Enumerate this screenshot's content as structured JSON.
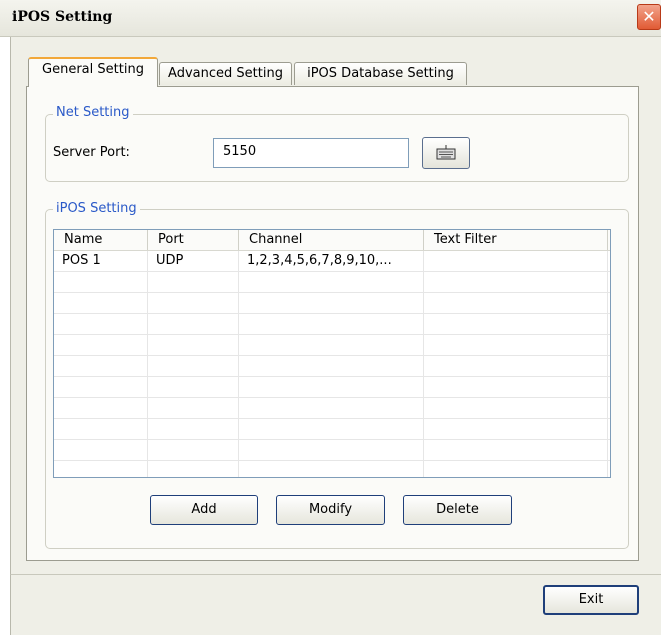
{
  "window": {
    "title": "iPOS Setting",
    "close_symbol": "✕"
  },
  "tabs": [
    {
      "label": "General Setting",
      "active": true
    },
    {
      "label": "Advanced Setting",
      "active": false
    },
    {
      "label": "iPOS Database Setting",
      "active": false
    }
  ],
  "net_setting": {
    "legend": "Net Setting",
    "server_port_label": "Server Port:",
    "server_port_value": "5150"
  },
  "ipos_setting": {
    "legend": "iPOS Setting",
    "columns": [
      "Name",
      "Port",
      "Channel",
      "Text Filter"
    ],
    "rows": [
      {
        "name": "POS 1",
        "port": "UDP",
        "channel": "1,2,3,4,5,6,7,8,9,10,...",
        "text_filter": ""
      }
    ],
    "buttons": {
      "add": "Add",
      "modify": "Modify",
      "delete": "Delete"
    }
  },
  "footer": {
    "exit_label": "Exit"
  },
  "colors": {
    "legend_text": "#2a59c8",
    "tab_highlight": "#f2a83a",
    "close_button": "#e15a34"
  }
}
